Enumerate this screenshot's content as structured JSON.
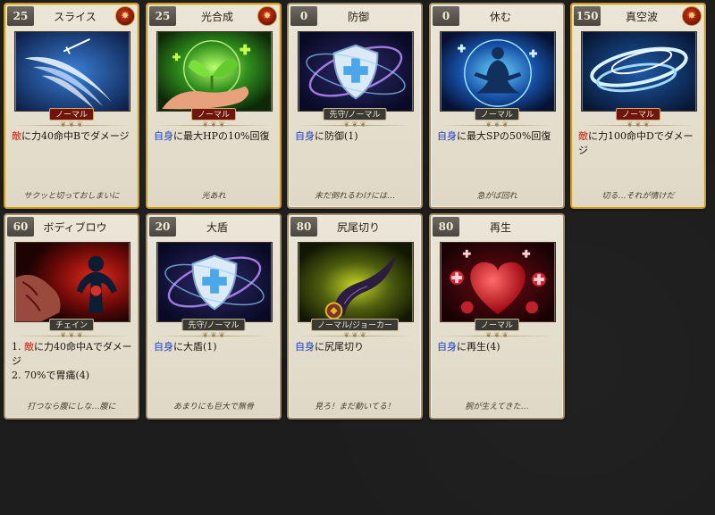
{
  "cards": [
    {
      "cost": "25",
      "name": "スライス",
      "rare": true,
      "emblem": "burst-emblem-icon",
      "art": "sword-slash-art",
      "tag": "ノーマル",
      "tag_style": "red",
      "desc": [
        {
          "k": "enemy",
          "t": "敵"
        },
        {
          "k": "text",
          "t": "に力40命中Bでダメージ"
        }
      ],
      "flavor": "サクッと切っておしまいに"
    },
    {
      "cost": "25",
      "name": "光合成",
      "rare": true,
      "emblem": "burst-emblem-icon",
      "art": "sprout-hand-art",
      "tag": "ノーマル",
      "tag_style": "red",
      "desc": [
        {
          "k": "self",
          "t": "自身"
        },
        {
          "k": "text",
          "t": "に最大HPの10%回復"
        }
      ],
      "flavor": "光あれ"
    },
    {
      "cost": "0",
      "name": "防御",
      "rare": false,
      "emblem": "",
      "art": "shield-art",
      "tag": "先守/ノーマル",
      "tag_style": "dark",
      "desc": [
        {
          "k": "self",
          "t": "自身"
        },
        {
          "k": "text",
          "t": "に防御(1)"
        }
      ],
      "flavor": "未だ倒れるわけには…"
    },
    {
      "cost": "0",
      "name": "休む",
      "rare": false,
      "emblem": "",
      "art": "meditate-art",
      "tag": "ノーマル",
      "tag_style": "dark",
      "desc": [
        {
          "k": "self",
          "t": "自身"
        },
        {
          "k": "text",
          "t": "に最大SPの50%回復"
        }
      ],
      "flavor": "急がば回れ"
    },
    {
      "cost": "150",
      "name": "真空波",
      "rare": true,
      "emblem": "burst-emblem-icon",
      "art": "vacuum-wave-art",
      "tag": "ノーマル",
      "tag_style": "red",
      "desc": [
        {
          "k": "enemy",
          "t": "敵"
        },
        {
          "k": "text",
          "t": "に力100命中Dでダメージ"
        }
      ],
      "flavor": "切る…それが情けだ"
    },
    {
      "cost": "60",
      "name": "ボディブロウ",
      "rare": false,
      "emblem": "",
      "art": "body-blow-art",
      "tag": "チェイン",
      "tag_style": "dark",
      "desc": [
        {
          "k": "text",
          "t": "1. "
        },
        {
          "k": "enemy",
          "t": "敵"
        },
        {
          "k": "text",
          "t": "に力40命中Aでダメージ"
        },
        {
          "k": "br",
          "t": ""
        },
        {
          "k": "text",
          "t": "2. 70%で胃痛(4)"
        }
      ],
      "flavor": "打つなら腹にしな…腹に"
    },
    {
      "cost": "20",
      "name": "大盾",
      "rare": false,
      "emblem": "",
      "art": "shield-art",
      "tag": "先守/ノーマル",
      "tag_style": "dark",
      "desc": [
        {
          "k": "self",
          "t": "自身"
        },
        {
          "k": "text",
          "t": "に大盾(1)"
        }
      ],
      "flavor": "あまりにも巨大で無骨"
    },
    {
      "cost": "80",
      "name": "尻尾切り",
      "rare": false,
      "emblem": "",
      "art": "tail-art",
      "tag": "ノーマル/ジョーカー",
      "tag_style": "dark",
      "desc": [
        {
          "k": "self",
          "t": "自身"
        },
        {
          "k": "text",
          "t": "に尻尾切り"
        }
      ],
      "flavor": "見ろ！まだ動いてる！"
    },
    {
      "cost": "80",
      "name": "再生",
      "rare": false,
      "emblem": "",
      "art": "heart-regen-art",
      "tag": "ノーマル",
      "tag_style": "dark",
      "desc": [
        {
          "k": "self",
          "t": "自身"
        },
        {
          "k": "text",
          "t": "に再生(4)"
        }
      ],
      "flavor": "腕が生えてきた…"
    }
  ]
}
